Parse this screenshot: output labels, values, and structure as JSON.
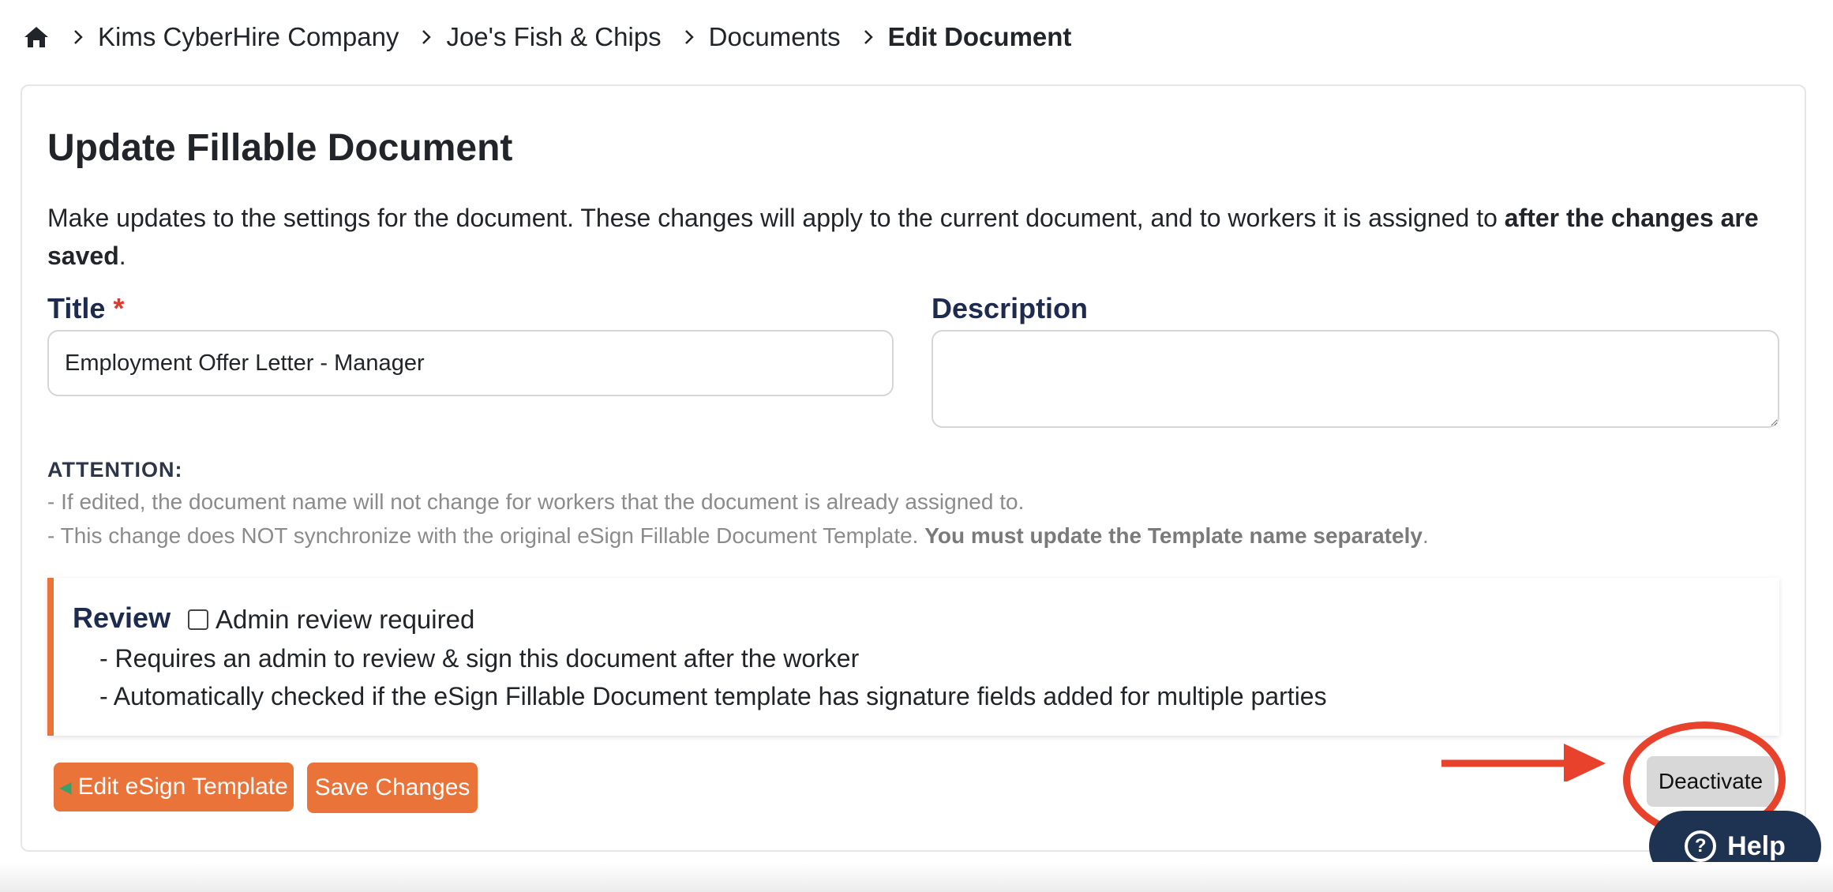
{
  "breadcrumb": {
    "home_icon": "home-icon",
    "items": [
      "Kims CyberHire Company",
      "Joe's Fish & Chips",
      "Documents",
      "Edit Document"
    ]
  },
  "page": {
    "title": "Update Fillable Document",
    "intro_text": "Make updates to the settings for the document. These changes will apply to the current document, and to workers it is assigned to ",
    "intro_bold": "after the changes are saved",
    "intro_end": "."
  },
  "form": {
    "title_label": "Title",
    "required_mark": "*",
    "title_value": "Employment Offer Letter - Manager",
    "description_label": "Description",
    "description_value": ""
  },
  "attention": {
    "heading": "ATTENTION:",
    "line1": "- If edited, the document name will not change for workers that the document is already assigned to.",
    "line2_text": "- This change does NOT synchronize with the original eSign Fillable Document Template. ",
    "line2_bold": "You must update the Template name separately",
    "line2_end": "."
  },
  "review": {
    "title": "Review",
    "checkbox_label": "Admin review required",
    "checked": false,
    "line1": "- Requires an admin to review & sign this document after the worker",
    "line2": "- Automatically checked if the eSign Fillable Document template has signature fields added for multiple parties"
  },
  "buttons": {
    "edit_template": "Edit eSign Template",
    "save_changes": "Save Changes",
    "deactivate": "Deactivate",
    "help": "Help"
  },
  "colors": {
    "accent": "#ea7339",
    "annotation": "#e8422c",
    "help_bg": "#1e3252"
  }
}
